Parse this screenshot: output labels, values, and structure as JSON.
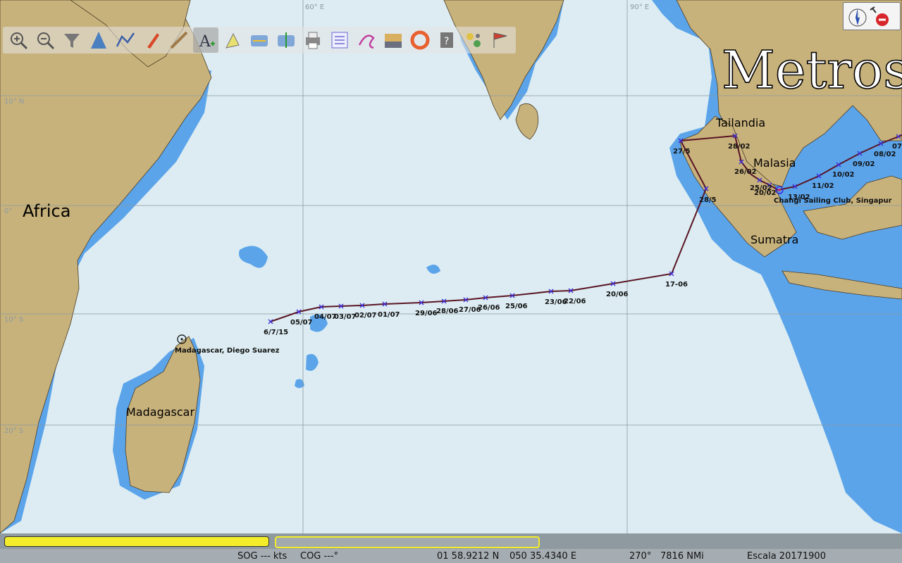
{
  "colors": {
    "land": "#c8b27c",
    "shallow_water": "#5ba4ea",
    "deep_water": "#dcecf2",
    "grid": "#8a9aa2",
    "route": "#5a1524",
    "waypoint_marker": "#3b2bd6"
  },
  "grid": {
    "lon_labels": [
      "60° E",
      "90° E"
    ],
    "lat_labels": [
      "10° N",
      "0°",
      "10° S",
      "20° S"
    ]
  },
  "regions": {
    "africa": "Africa",
    "madagascar": "Madagascar",
    "tailandia": "Tailandia",
    "malasia": "Malasia",
    "sumatra": "Sumatra"
  },
  "watermark": "Metros",
  "ports": {
    "diego_suarez": "Madagascar, Diego Suarez",
    "changi": "Changi Sailing Club, Singapur"
  },
  "waypoints": [
    "6/7/15",
    "05/07",
    "04/07",
    "03/07",
    "02/07",
    "01/07",
    "29/06",
    "28/06",
    "27/06",
    "26/06",
    "25/06",
    "23/06",
    "22/06",
    "20/06",
    "17-06",
    "28/5",
    "27/5",
    "28/02",
    "26/02",
    "25/02",
    "20/02",
    "13/02",
    "11/02",
    "10/02",
    "09/02",
    "08/02",
    "07"
  ],
  "toolbar": [
    {
      "name": "zoom-in-icon"
    },
    {
      "name": "zoom-out-icon"
    },
    {
      "name": "filter-icon"
    },
    {
      "name": "waypoint-icon"
    },
    {
      "name": "route-icon"
    },
    {
      "name": "boat-icon"
    },
    {
      "name": "measure-icon"
    },
    {
      "name": "text-tool-icon",
      "active": true
    },
    {
      "name": "mark-icon"
    },
    {
      "name": "width-icon"
    },
    {
      "name": "height-icon"
    },
    {
      "name": "print-icon"
    },
    {
      "name": "checklist-icon"
    },
    {
      "name": "track-icon"
    },
    {
      "name": "tide-icon"
    },
    {
      "name": "lifebuoy-icon"
    },
    {
      "name": "help-icon"
    },
    {
      "name": "settings-icon"
    },
    {
      "name": "flags-icon"
    }
  ],
  "status": {
    "sog": "SOG --- kts",
    "cog": "COG ---°",
    "lat": "01 58.9212 N",
    "lon": "050 35.4340 E",
    "bearing": "270°",
    "distance": "7816 NMi",
    "scale": "Escala 20171900"
  }
}
